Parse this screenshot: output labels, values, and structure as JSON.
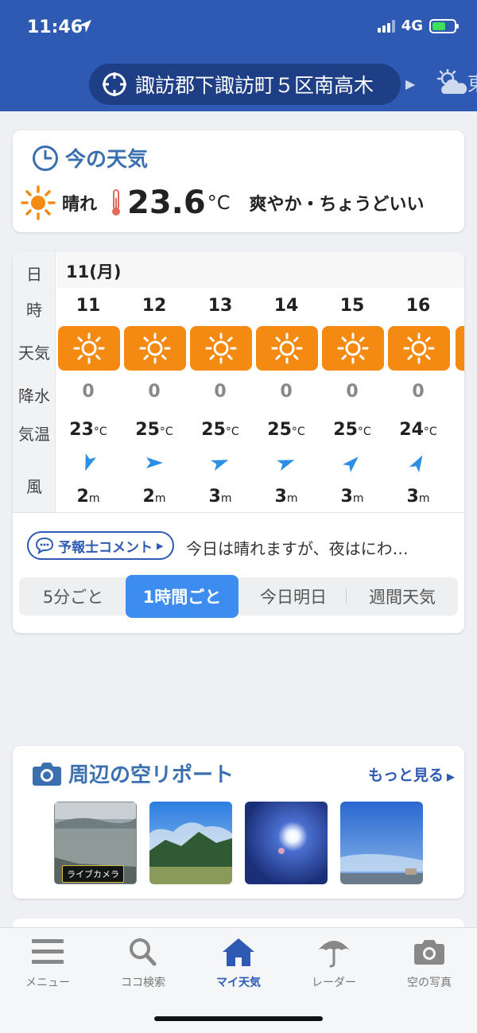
{
  "status_bar": {
    "time": "11:46",
    "network": "4G"
  },
  "header": {
    "location": "諏訪郡下諏訪町５区南高木",
    "next_location_partial": "東"
  },
  "current_weather": {
    "title": "今の天気",
    "condition": "晴れ",
    "temperature": "23.6",
    "temp_unit": "°C",
    "feel": "爽やか・ちょうどいい",
    "icon": "sun-icon"
  },
  "hourly": {
    "row_labels": {
      "day": "日",
      "hour": "時",
      "weather": "天気",
      "precip": "降水",
      "temp": "気温",
      "wind": "風"
    },
    "day": "11(月)",
    "columns": [
      {
        "hour": "11",
        "precip": "0",
        "temp": "23",
        "wind_speed": "2",
        "wind_dir_deg": 200
      },
      {
        "hour": "12",
        "precip": "0",
        "temp": "25",
        "wind_speed": "2",
        "wind_dir_deg": 90
      },
      {
        "hour": "13",
        "precip": "0",
        "temp": "25",
        "wind_speed": "3",
        "wind_dir_deg": 70
      },
      {
        "hour": "14",
        "precip": "0",
        "temp": "25",
        "wind_speed": "3",
        "wind_dir_deg": 70
      },
      {
        "hour": "15",
        "precip": "0",
        "temp": "25",
        "wind_speed": "3",
        "wind_dir_deg": 45
      },
      {
        "hour": "16",
        "precip": "0",
        "temp": "24",
        "wind_speed": "3",
        "wind_dir_deg": 30
      }
    ],
    "temp_unit": "°C",
    "wind_unit": "m"
  },
  "comment": {
    "label": "予報士コメント",
    "text": "今日は晴れますが、夜はにわ…"
  },
  "tabs": [
    {
      "label": "5分ごと",
      "active": false
    },
    {
      "label": "1時間ごと",
      "active": true
    },
    {
      "label": "今日明日",
      "active": false
    },
    {
      "label": "週間天気",
      "active": false
    }
  ],
  "sky_report": {
    "title": "周辺の空リポート",
    "more": "もっと見る",
    "live_label": "ライブカメラ"
  },
  "bottom_nav": [
    {
      "label": "メニュー",
      "icon": "menu-icon"
    },
    {
      "label": "ココ検索",
      "icon": "search-icon"
    },
    {
      "label": "マイ天気",
      "icon": "home-icon",
      "active": true
    },
    {
      "label": "レーダー",
      "icon": "umbrella-icon"
    },
    {
      "label": "空の写真",
      "icon": "camera-icon"
    }
  ],
  "colors": {
    "brand": "#2e5ab4",
    "sun_tile": "#f58a12",
    "tab_active": "#3d8df0"
  }
}
